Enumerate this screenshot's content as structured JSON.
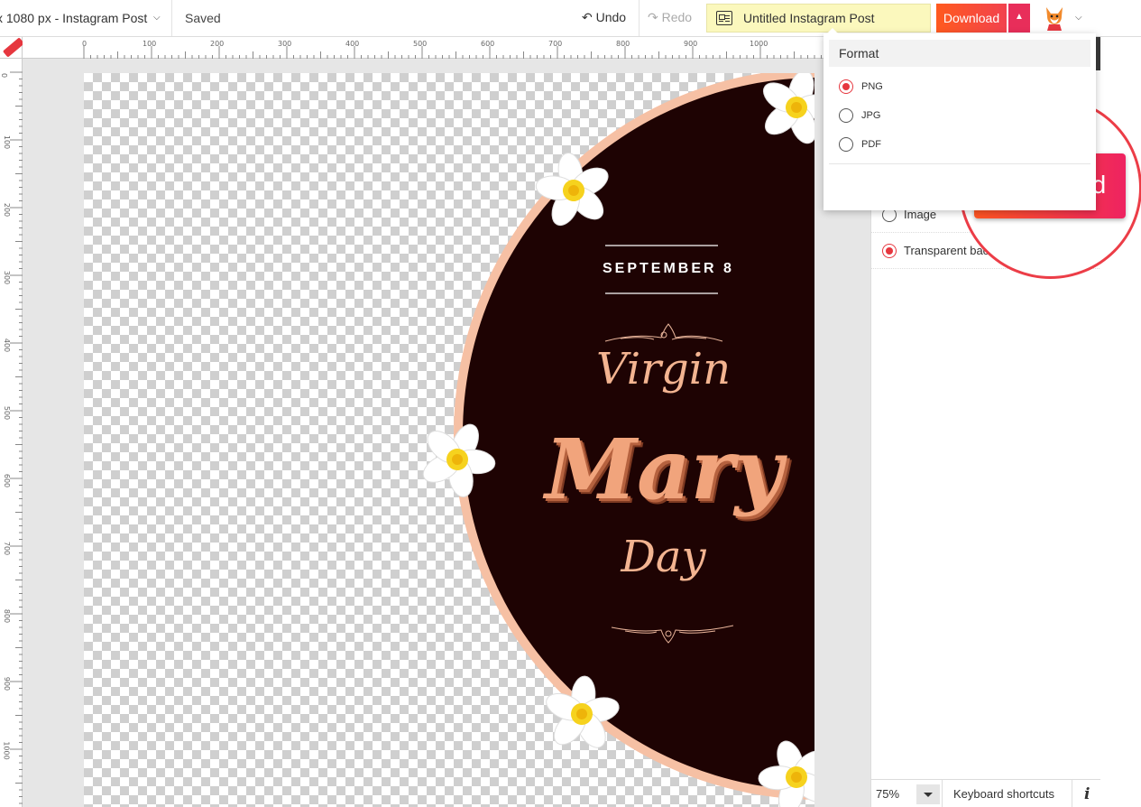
{
  "topbar": {
    "size_label": "x 1080 px - Instagram Post",
    "saved": "Saved",
    "undo": "Undo",
    "redo": "Redo",
    "document_name": "Untitled Instagram Post",
    "download": "Download"
  },
  "ruler": {
    "top_ticks": [
      "0",
      "100",
      "200",
      "300",
      "400",
      "500",
      "600",
      "700",
      "800",
      "900",
      "1000"
    ],
    "left_ticks": [
      "0",
      "100",
      "200",
      "300",
      "400",
      "500",
      "600",
      "700",
      "800",
      "900",
      "1000"
    ]
  },
  "design": {
    "date": "SEPTEMBER 8",
    "line1": "Virgin",
    "line2": "Mary",
    "line3": "Day",
    "colors": {
      "circle_fill": "#1e0303",
      "circle_border": "#f6c0a4",
      "title_peach": "#f3b491"
    }
  },
  "format_popup": {
    "title": "Format",
    "options": [
      {
        "label": "PNG",
        "selected": true
      },
      {
        "label": "JPG",
        "selected": false
      },
      {
        "label": "PDF",
        "selected": false
      }
    ]
  },
  "background_options": [
    {
      "label": "Image",
      "selected": false
    },
    {
      "label": "Transparent background",
      "selected": true
    }
  ],
  "highlight_button": "Download",
  "bottombar": {
    "zoom": "75%",
    "keyboard_shortcuts": "Keyboard shortcuts",
    "info": "i"
  },
  "accent_color": "#ff5a1f"
}
